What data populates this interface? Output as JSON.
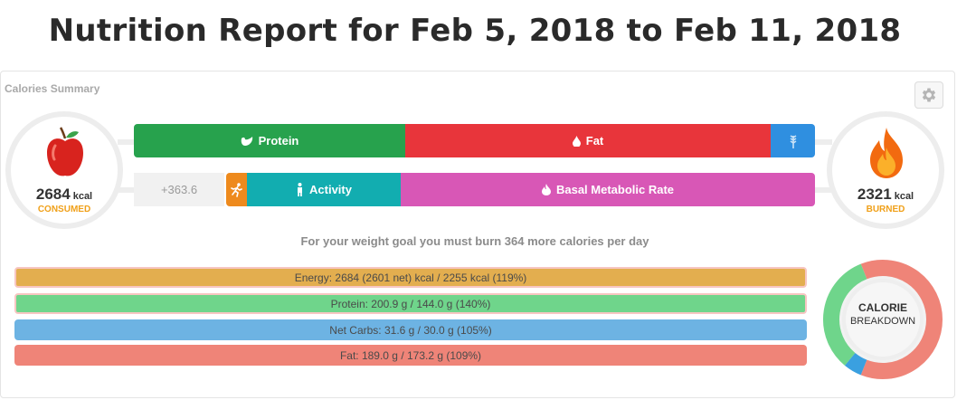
{
  "page": {
    "title": "Nutrition Report for Feb 5, 2018 to Feb 11, 2018"
  },
  "summary": {
    "label": "Calories Summary",
    "consumed": {
      "value": "2684",
      "unit": "kcal",
      "caption": "CONSUMED"
    },
    "burned": {
      "value": "2321",
      "unit": "kcal",
      "caption": "BURNED"
    },
    "surplus": "+363.6",
    "goal_message": "For your weight goal you must burn 364 more calories per day"
  },
  "intake_bar": {
    "protein_label": "Protein",
    "fat_label": "Fat",
    "segments": {
      "protein": 0.399,
      "fat": 0.537,
      "carbs": 0.064
    },
    "colors": {
      "protein": "#27a24d",
      "fat": "#e8353b",
      "carbs": "#2f8fe0"
    }
  },
  "expenditure_bar": {
    "activity_label": "Activity",
    "bmr_label": "Basal Metabolic Rate",
    "colors": {
      "exercise": "#ee8a1d",
      "activity": "#12adb0",
      "bmr": "#d857b6"
    }
  },
  "targets": [
    {
      "text": "Energy: 2684 (2601 net) kcal / 2255 kcal (119%)",
      "color": "#e3ae4f"
    },
    {
      "text": "Protein: 200.9 g / 144.0 g (140%)",
      "color": "#6fd58b"
    },
    {
      "text": "Net Carbs: 31.6 g / 30.0 g (105%)",
      "color": "#6db3e3"
    },
    {
      "text": "Fat: 189.0 g / 173.2 g (109%)",
      "color": "#ef8478"
    }
  ],
  "breakdown": {
    "line1": "CALORIE",
    "line2": "BREAKDOWN",
    "fractions": {
      "fat": 0.62,
      "carbs": 0.05,
      "protein": 0.33
    }
  },
  "icons": {
    "settings": "gear-icon",
    "consumed": "apple-icon",
    "burned": "flame-icon"
  }
}
